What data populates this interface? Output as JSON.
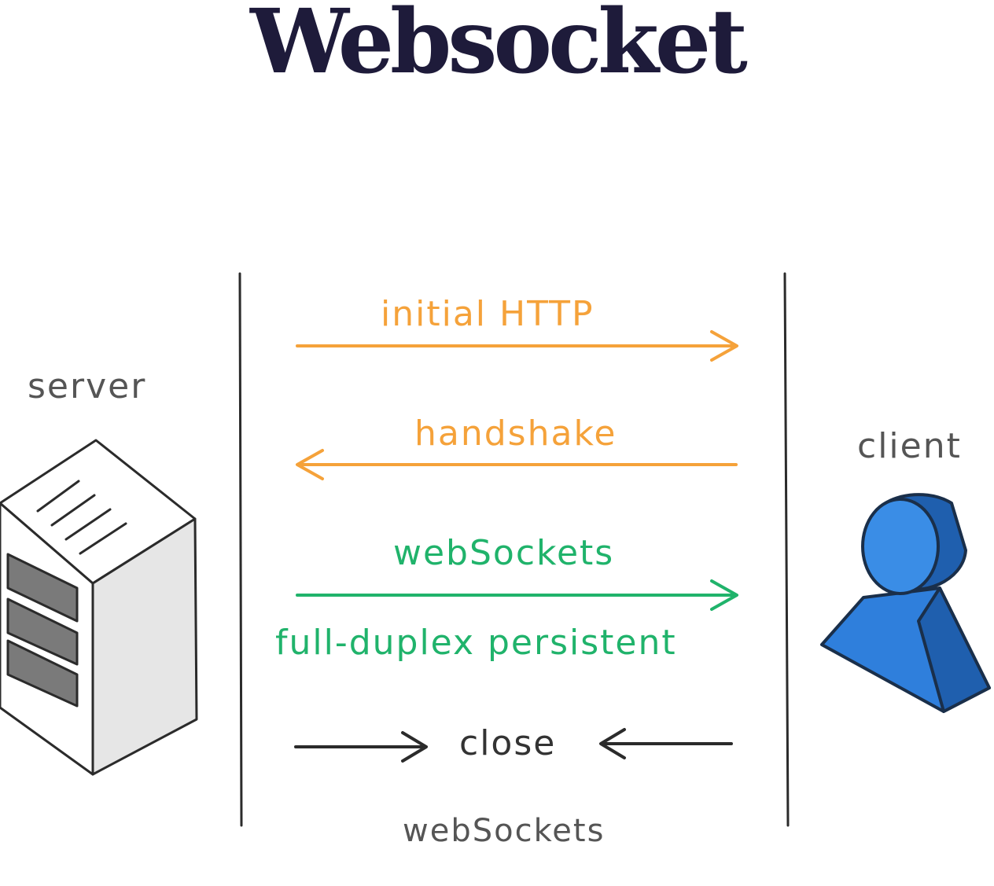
{
  "title": "Websocket",
  "nodes": {
    "server_label": "server",
    "client_label": "client"
  },
  "messages": [
    {
      "label": "initial HTTP",
      "direction": "server-to-client",
      "color": "#f5a23a"
    },
    {
      "label": "handshake",
      "direction": "client-to-server",
      "color": "#f5a23a"
    },
    {
      "label": "webSockets",
      "direction": "server-to-client",
      "color": "#20b36b"
    },
    {
      "label": "full-duplex persistent",
      "color": "#20b36b"
    },
    {
      "label": "close",
      "direction": "both-inward",
      "color": "#333333"
    }
  ],
  "footer_label": "webSockets",
  "colors": {
    "title": "#1e1b3a",
    "http": "#f5a23a",
    "websocket": "#20b36b",
    "close": "#333333",
    "label_gray": "#555555",
    "client_blue": "#2f7fdc"
  },
  "icons": [
    "server-icon",
    "client-user-icon"
  ]
}
